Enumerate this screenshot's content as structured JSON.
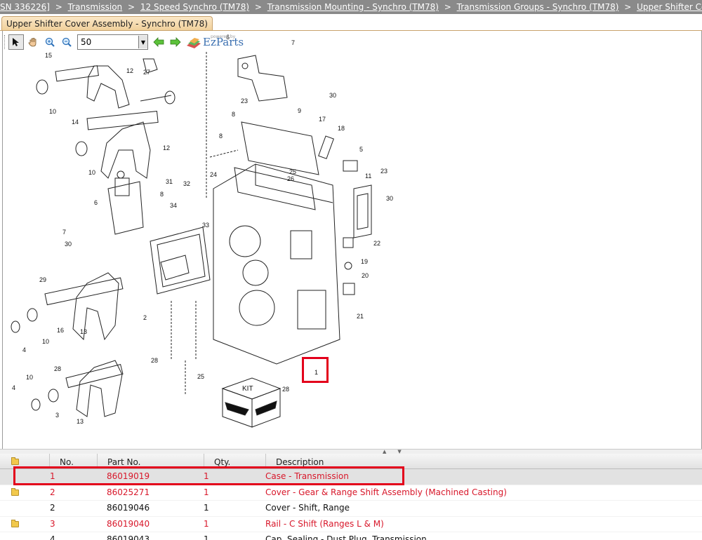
{
  "breadcrumb": {
    "lead": "SN 336226]",
    "items": [
      "Transmission",
      "12 Speed Synchro (TM78)",
      "Transmission Mounting - Synchro (TM78)",
      "Transmission Groups - Synchro (TM78)",
      "Upper Shifter Cover Assembly"
    ],
    "separator": ">"
  },
  "tab": {
    "label": "Upper Shifter Cover Assembly - Synchro (TM78)"
  },
  "toolbar": {
    "zoom_value": "50",
    "brand_powered": "powered by",
    "brand_name": "EzParts",
    "icons": [
      "select-arrow-icon",
      "pan-hand-icon",
      "zoom-in-icon",
      "zoom-out-icon",
      "back-arrow-icon",
      "forward-arrow-icon"
    ]
  },
  "diagram": {
    "labels": [
      "15",
      "12",
      "27",
      "10",
      "14",
      "12",
      "10",
      "6",
      "7",
      "30",
      "29",
      "16",
      "4",
      "10",
      "13",
      "28",
      "10",
      "4",
      "3",
      "13",
      "2",
      "31",
      "32",
      "8",
      "34",
      "33",
      "6",
      "23",
      "8",
      "8",
      "9",
      "17",
      "18",
      "5",
      "30",
      "24",
      "25",
      "26",
      "11",
      "23",
      "30",
      "22",
      "19",
      "20",
      "21",
      "28",
      "25",
      "1",
      "7",
      "KIT",
      "28"
    ]
  },
  "table": {
    "headers": [
      "No.",
      "Part No.",
      "Qty.",
      "Description"
    ],
    "rows": [
      {
        "no": "1",
        "part": "86019019",
        "qty": "1",
        "desc": "Case - Transmission",
        "folder": false,
        "color": "red",
        "selected": true
      },
      {
        "no": "2",
        "part": "86025271",
        "qty": "1",
        "desc": "Cover - Gear & Range Shift Assembly (Machined Casting)",
        "folder": true,
        "color": "red",
        "selected": false
      },
      {
        "no": "2",
        "part": "86019046",
        "qty": "1",
        "desc": "Cover - Shift, Range",
        "folder": false,
        "color": "black",
        "selected": false
      },
      {
        "no": "3",
        "part": "86019040",
        "qty": "1",
        "desc": "Rail - C Shift (Ranges L & M)",
        "folder": true,
        "color": "red",
        "selected": false
      },
      {
        "no": "4",
        "part": "86019043",
        "qty": "1",
        "desc": "Cap, Sealing - Dust Plug, Transmission",
        "folder": false,
        "color": "black",
        "selected": false
      }
    ]
  },
  "colors": {
    "highlight": "#e3001b",
    "part_link": "#d8172a",
    "breadcrumb_bg": "#8a8a8a"
  }
}
